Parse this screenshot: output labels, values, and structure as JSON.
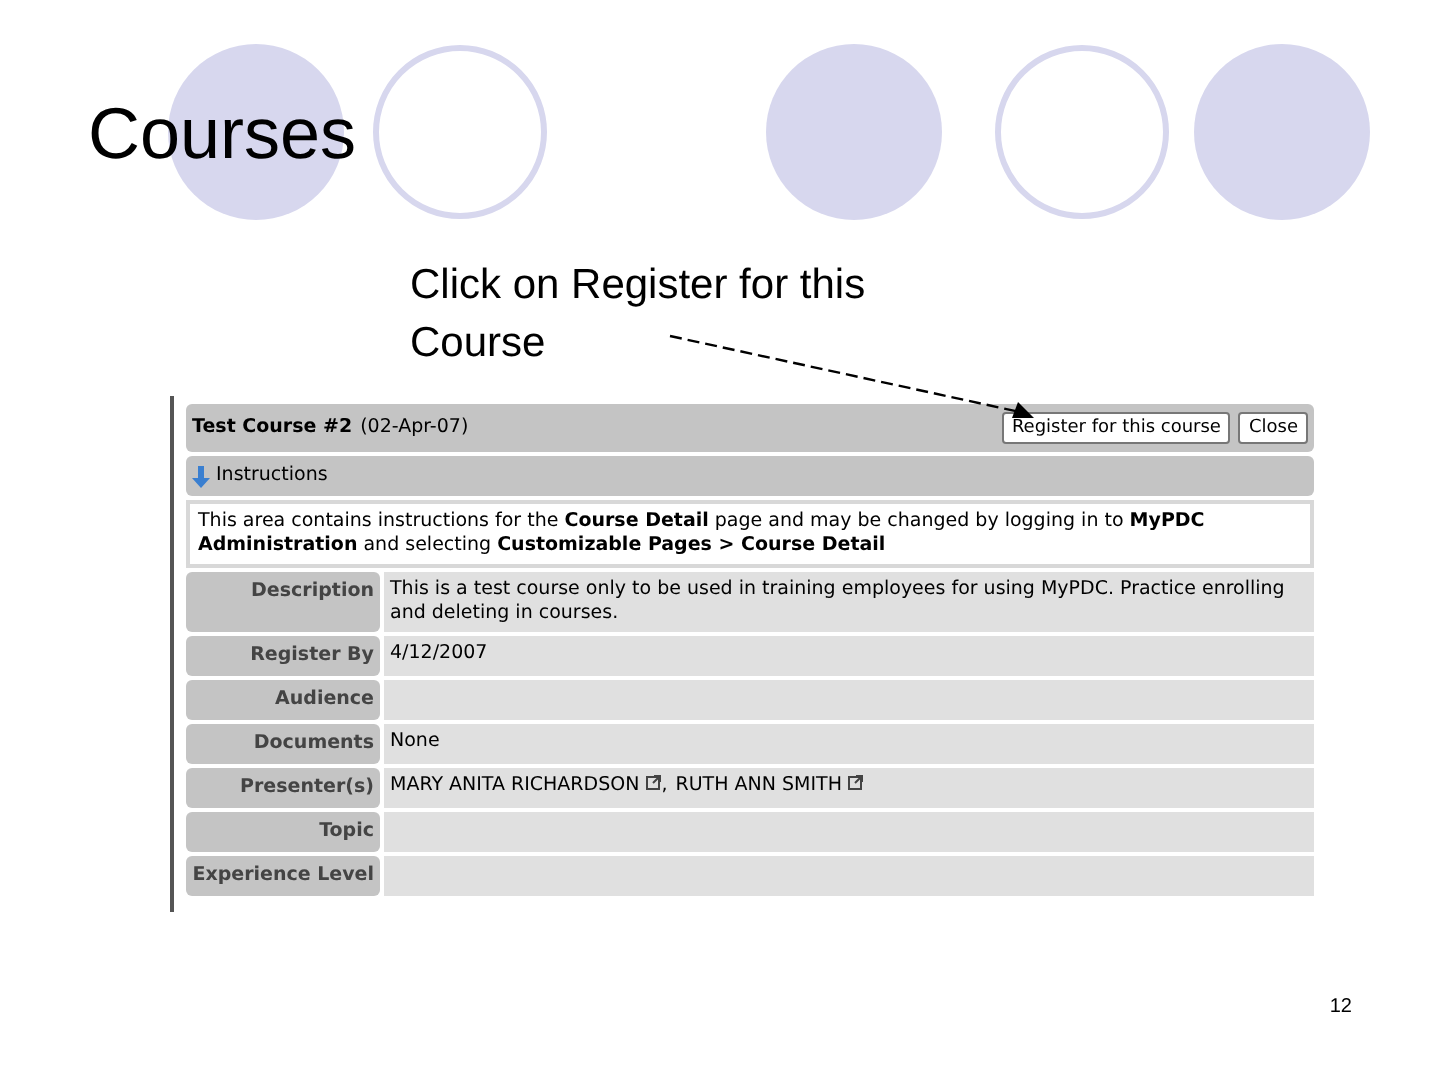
{
  "slide": {
    "title": "Courses",
    "callout": "Click on Register for this Course",
    "page_number": "12"
  },
  "course": {
    "title": "Test Course #2",
    "date": "(02-Apr-07)",
    "buttons": [
      "Register for this course",
      "Close"
    ]
  },
  "instructions": {
    "label": "Instructions",
    "expanded": true,
    "text": "This area contains instructions for the **Course Detail** page and may be changed by logging in to **MyPDC Administration** and selecting **Customizable Pages > Course Detail**"
  },
  "details": [
    {
      "label": "Description",
      "value": "This is a test course only to be used in training employees for using MyPDC. Practice enrolling and deleting in courses."
    },
    {
      "label": "Register By",
      "value": "4/12/2007"
    },
    {
      "label": "Audience"
    },
    {
      "label": "Documents",
      "value": "None"
    },
    {
      "label": "Presenter(s)",
      "presenters": [
        "MARY ANITA RICHARDSON",
        "RUTH ANN SMITH"
      ],
      "separator": ","
    },
    {
      "label": "Topic"
    },
    {
      "label": "Experience Level"
    }
  ]
}
